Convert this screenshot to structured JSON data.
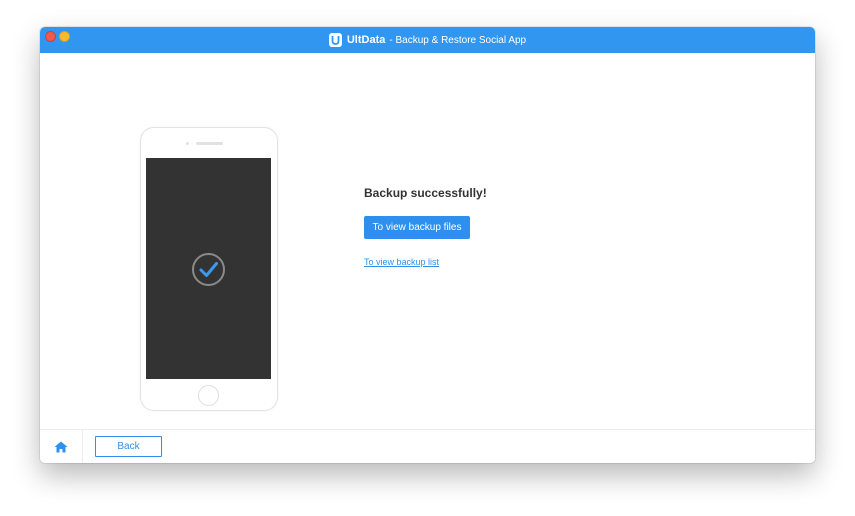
{
  "window": {
    "app_name": "UltData",
    "title_suffix": "- Backup & Restore Social App",
    "logo_letter": "U",
    "colors": {
      "titlebar": "#3196f0",
      "accent": "#2e90ee",
      "phone_screen": "#333333"
    }
  },
  "phone": {
    "status_icon": "check-circle-icon"
  },
  "result": {
    "message": "Backup successfully!",
    "view_files_label": "To view backup files",
    "view_list_label": "To view backup list"
  },
  "footer": {
    "home_icon": "home-icon",
    "back_label": "Back"
  }
}
